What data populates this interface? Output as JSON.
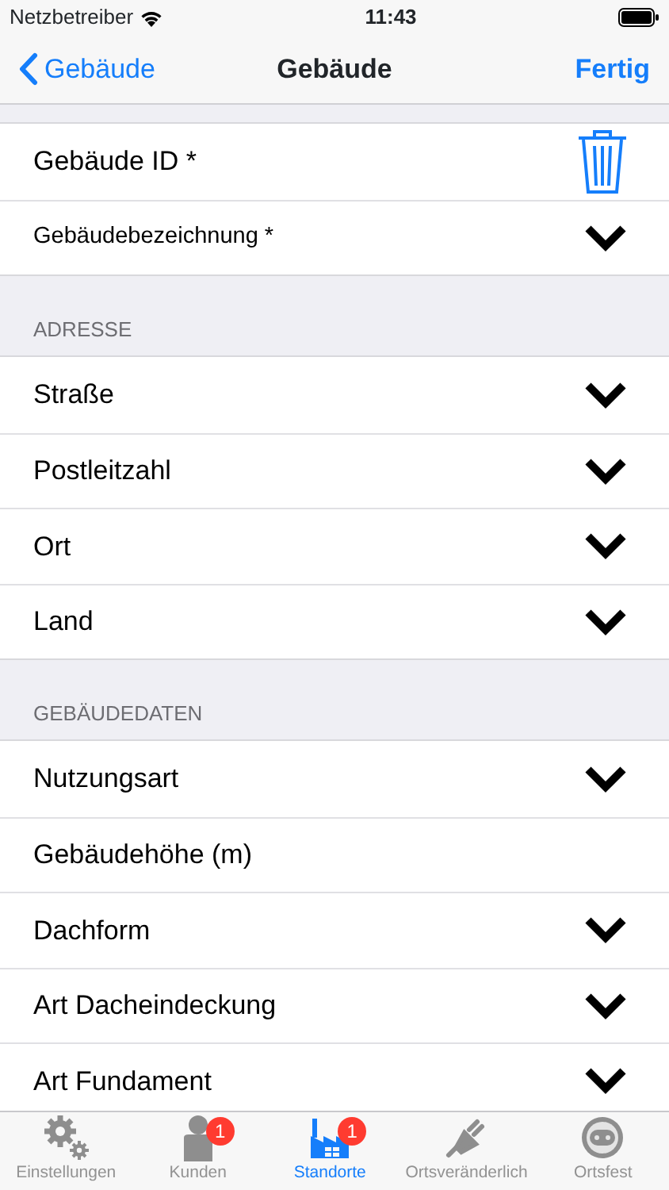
{
  "status_bar": {
    "carrier": "Netzbetreiber",
    "time": "11:43"
  },
  "nav": {
    "back": "Gebäude",
    "title": "Gebäude",
    "done": "Fertig"
  },
  "sections": [
    {
      "rows": [
        {
          "label": "Gebäude ID *",
          "kind": "trash",
          "compact": false
        },
        {
          "label": "Gebäudebezeichnung *",
          "kind": "select",
          "compact": true
        }
      ]
    },
    {
      "header": "ADRESSE",
      "rows": [
        {
          "label": "Straße",
          "kind": "select",
          "compact": false
        },
        {
          "label": "Postleitzahl",
          "kind": "select",
          "compact": false
        },
        {
          "label": "Ort",
          "kind": "select",
          "compact": false
        },
        {
          "label": "Land",
          "kind": "select",
          "compact": false
        }
      ]
    },
    {
      "header": "GEBÄUDEDATEN",
      "rows": [
        {
          "label": "Nutzungsart",
          "kind": "select",
          "compact": false
        },
        {
          "label": "Gebäudehöhe (m)",
          "kind": "text",
          "compact": false
        },
        {
          "label": "Dachform",
          "kind": "select",
          "compact": false
        },
        {
          "label": "Art Dacheindeckung",
          "kind": "select",
          "compact": false
        },
        {
          "label": "Art Fundament",
          "kind": "select",
          "compact": false
        }
      ]
    }
  ],
  "tabs": [
    {
      "label": "Einstellungen",
      "kind": "gears",
      "selected": false
    },
    {
      "label": "Kunden",
      "kind": "person",
      "selected": false,
      "badge": "1"
    },
    {
      "label": "Standorte",
      "kind": "factory",
      "selected": true,
      "badge": "1"
    },
    {
      "label": "Ortsveränderlich",
      "kind": "plug",
      "selected": false
    },
    {
      "label": "Ortsfest",
      "kind": "socket",
      "selected": false
    }
  ]
}
